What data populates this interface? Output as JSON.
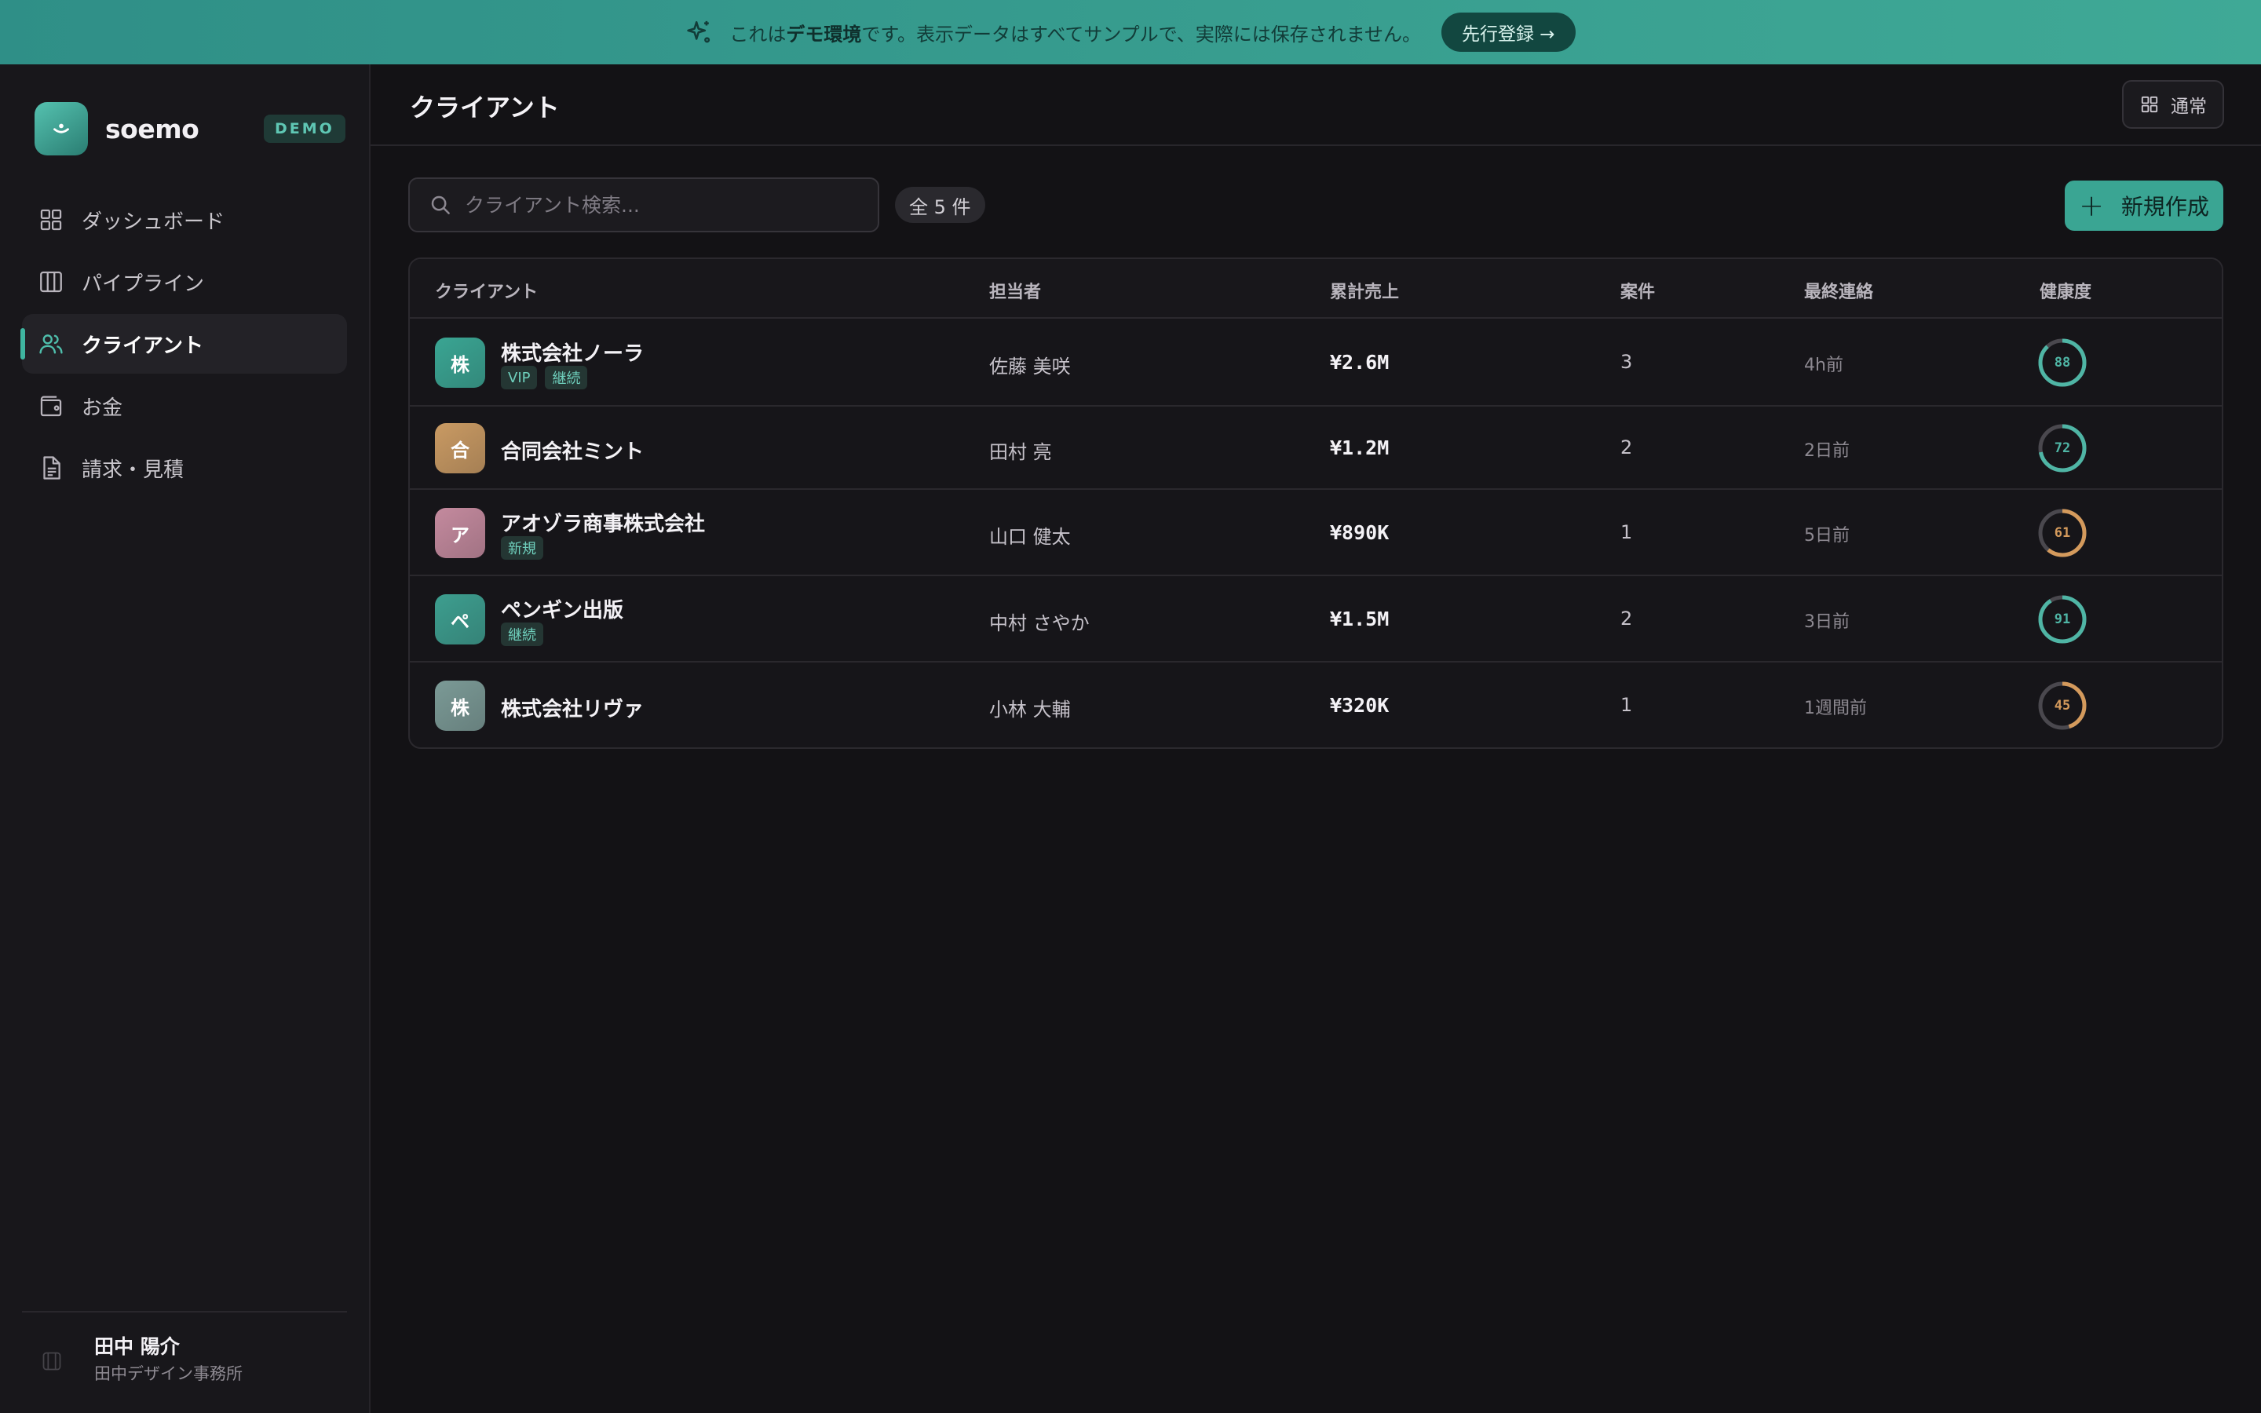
{
  "banner": {
    "prefix": "これは",
    "emph": "デモ環境",
    "suffix": "です。表示データはすべてサンプルで、実際には保存されません。",
    "cta": "先行登録 →",
    "color": "#3aa593"
  },
  "sidebar": {
    "brand": "soemo",
    "badge": "DEMO",
    "items": [
      {
        "label": "ダッシュボード",
        "icon": "dashboard-grid-icon"
      },
      {
        "label": "パイプライン",
        "icon": "pipeline-columns-icon"
      },
      {
        "label": "クライアント",
        "icon": "users-icon",
        "active": true
      },
      {
        "label": "お金",
        "icon": "wallet-icon"
      },
      {
        "label": "請求・見積",
        "icon": "document-icon"
      }
    ],
    "user": {
      "name": "田中 陽介",
      "org": "田中デザイン事務所"
    }
  },
  "header": {
    "title": "クライアント",
    "view_toggle": "通常"
  },
  "toolbar": {
    "search_placeholder": "クライアント検索...",
    "count": "全 5 件",
    "new_button": "新規作成"
  },
  "table": {
    "columns": [
      "クライアント",
      "担当者",
      "累計売上",
      "案件",
      "最終連絡",
      "健康度"
    ],
    "rows": [
      {
        "initial": "株",
        "name": "株式会社ノーラ",
        "tags": [
          "VIP",
          "継続"
        ],
        "contact": "佐藤 美咲",
        "revenue": "¥2.6M",
        "deals": "3",
        "last": "4h前",
        "health": "88",
        "avatar_color": "#3aa593",
        "health_color": "#4fb5a5"
      },
      {
        "initial": "合",
        "name": "合同会社ミント",
        "tags": [],
        "contact": "田村 亮",
        "revenue": "¥1.2M",
        "deals": "2",
        "last": "2日前",
        "health": "72",
        "avatar_color": "#c99a63",
        "health_color": "#4fb5a5"
      },
      {
        "initial": "ア",
        "name": "アオゾラ商事株式会社",
        "tags": [
          "新規"
        ],
        "contact": "山口 健太",
        "revenue": "¥890K",
        "deals": "1",
        "last": "5日前",
        "health": "61",
        "avatar_color": "#c48a9e",
        "health_color": "#d49a5c"
      },
      {
        "initial": "ペ",
        "name": "ペンギン出版",
        "tags": [
          "継続"
        ],
        "contact": "中村 さやか",
        "revenue": "¥1.5M",
        "deals": "2",
        "last": "3日前",
        "health": "91",
        "avatar_color": "#3d9e8f",
        "health_color": "#4fb5a5"
      },
      {
        "initial": "株",
        "name": "株式会社リヴァ",
        "tags": [],
        "contact": "小林 大輔",
        "revenue": "¥320K",
        "deals": "1",
        "last": "1週間前",
        "health": "45",
        "avatar_color": "#7b9a96",
        "health_color": "#d49a5c"
      }
    ]
  }
}
